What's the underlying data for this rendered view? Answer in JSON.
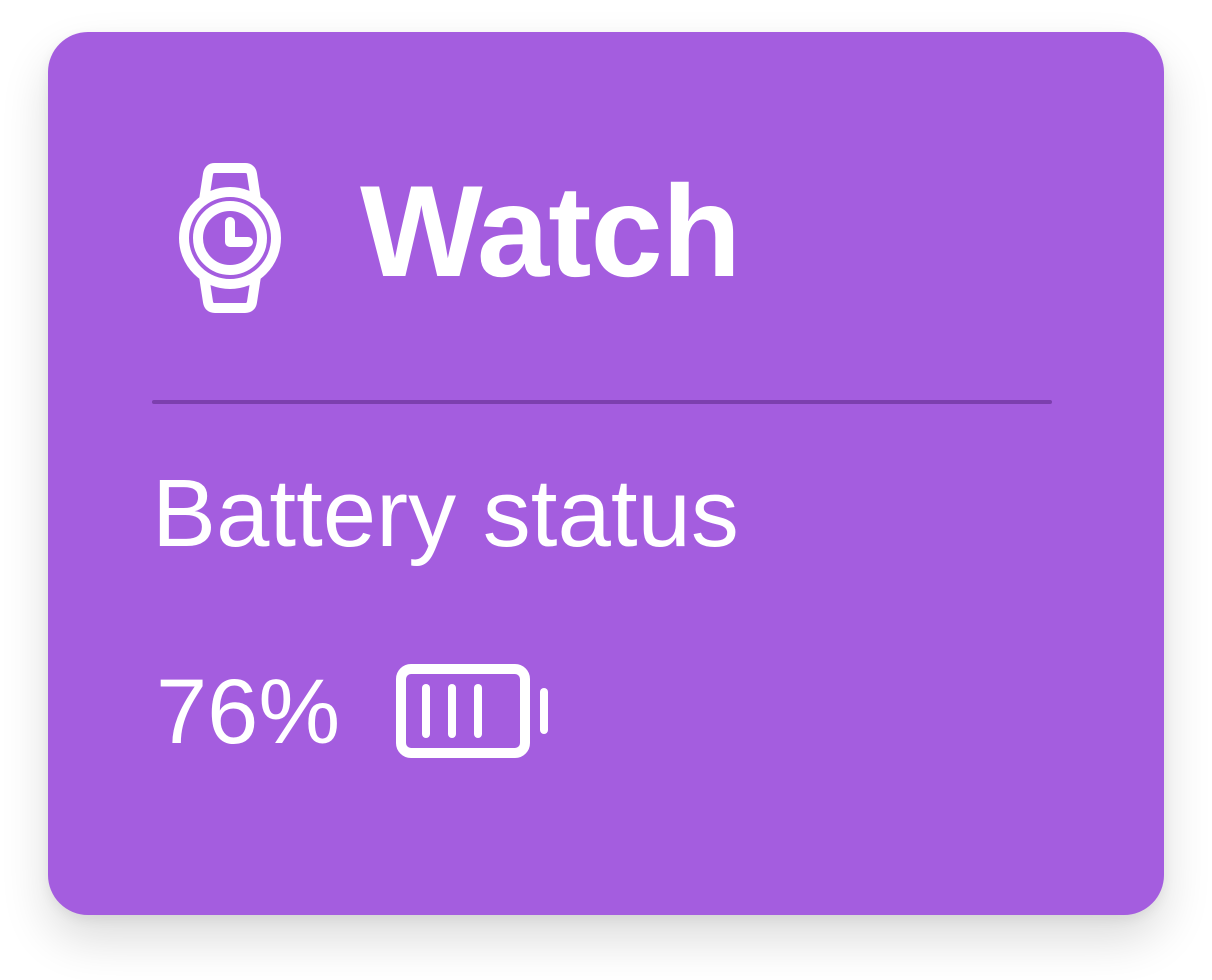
{
  "card": {
    "title": "Watch",
    "icon": "watch-icon",
    "subtitle": "Battery status",
    "battery": {
      "percent_label": "76%",
      "level": 0.76,
      "icon": "battery-icon"
    }
  },
  "colors": {
    "card_background": "#a45ddf",
    "divider": "#7c3fae",
    "text": "#ffffff"
  }
}
